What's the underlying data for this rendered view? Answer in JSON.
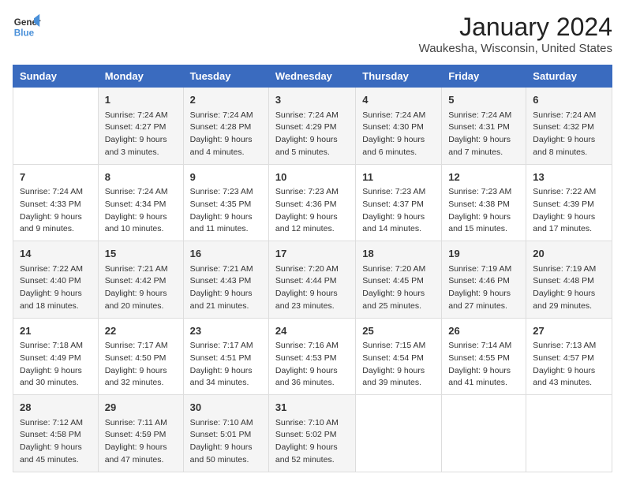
{
  "logo": {
    "line1": "General",
    "line2": "Blue"
  },
  "title": "January 2024",
  "subtitle": "Waukesha, Wisconsin, United States",
  "days_of_week": [
    "Sunday",
    "Monday",
    "Tuesday",
    "Wednesday",
    "Thursday",
    "Friday",
    "Saturday"
  ],
  "weeks": [
    [
      {
        "day": "",
        "content": ""
      },
      {
        "day": "1",
        "content": "Sunrise: 7:24 AM\nSunset: 4:27 PM\nDaylight: 9 hours\nand 3 minutes."
      },
      {
        "day": "2",
        "content": "Sunrise: 7:24 AM\nSunset: 4:28 PM\nDaylight: 9 hours\nand 4 minutes."
      },
      {
        "day": "3",
        "content": "Sunrise: 7:24 AM\nSunset: 4:29 PM\nDaylight: 9 hours\nand 5 minutes."
      },
      {
        "day": "4",
        "content": "Sunrise: 7:24 AM\nSunset: 4:30 PM\nDaylight: 9 hours\nand 6 minutes."
      },
      {
        "day": "5",
        "content": "Sunrise: 7:24 AM\nSunset: 4:31 PM\nDaylight: 9 hours\nand 7 minutes."
      },
      {
        "day": "6",
        "content": "Sunrise: 7:24 AM\nSunset: 4:32 PM\nDaylight: 9 hours\nand 8 minutes."
      }
    ],
    [
      {
        "day": "7",
        "content": "Sunrise: 7:24 AM\nSunset: 4:33 PM\nDaylight: 9 hours\nand 9 minutes."
      },
      {
        "day": "8",
        "content": "Sunrise: 7:24 AM\nSunset: 4:34 PM\nDaylight: 9 hours\nand 10 minutes."
      },
      {
        "day": "9",
        "content": "Sunrise: 7:23 AM\nSunset: 4:35 PM\nDaylight: 9 hours\nand 11 minutes."
      },
      {
        "day": "10",
        "content": "Sunrise: 7:23 AM\nSunset: 4:36 PM\nDaylight: 9 hours\nand 12 minutes."
      },
      {
        "day": "11",
        "content": "Sunrise: 7:23 AM\nSunset: 4:37 PM\nDaylight: 9 hours\nand 14 minutes."
      },
      {
        "day": "12",
        "content": "Sunrise: 7:23 AM\nSunset: 4:38 PM\nDaylight: 9 hours\nand 15 minutes."
      },
      {
        "day": "13",
        "content": "Sunrise: 7:22 AM\nSunset: 4:39 PM\nDaylight: 9 hours\nand 17 minutes."
      }
    ],
    [
      {
        "day": "14",
        "content": "Sunrise: 7:22 AM\nSunset: 4:40 PM\nDaylight: 9 hours\nand 18 minutes."
      },
      {
        "day": "15",
        "content": "Sunrise: 7:21 AM\nSunset: 4:42 PM\nDaylight: 9 hours\nand 20 minutes."
      },
      {
        "day": "16",
        "content": "Sunrise: 7:21 AM\nSunset: 4:43 PM\nDaylight: 9 hours\nand 21 minutes."
      },
      {
        "day": "17",
        "content": "Sunrise: 7:20 AM\nSunset: 4:44 PM\nDaylight: 9 hours\nand 23 minutes."
      },
      {
        "day": "18",
        "content": "Sunrise: 7:20 AM\nSunset: 4:45 PM\nDaylight: 9 hours\nand 25 minutes."
      },
      {
        "day": "19",
        "content": "Sunrise: 7:19 AM\nSunset: 4:46 PM\nDaylight: 9 hours\nand 27 minutes."
      },
      {
        "day": "20",
        "content": "Sunrise: 7:19 AM\nSunset: 4:48 PM\nDaylight: 9 hours\nand 29 minutes."
      }
    ],
    [
      {
        "day": "21",
        "content": "Sunrise: 7:18 AM\nSunset: 4:49 PM\nDaylight: 9 hours\nand 30 minutes."
      },
      {
        "day": "22",
        "content": "Sunrise: 7:17 AM\nSunset: 4:50 PM\nDaylight: 9 hours\nand 32 minutes."
      },
      {
        "day": "23",
        "content": "Sunrise: 7:17 AM\nSunset: 4:51 PM\nDaylight: 9 hours\nand 34 minutes."
      },
      {
        "day": "24",
        "content": "Sunrise: 7:16 AM\nSunset: 4:53 PM\nDaylight: 9 hours\nand 36 minutes."
      },
      {
        "day": "25",
        "content": "Sunrise: 7:15 AM\nSunset: 4:54 PM\nDaylight: 9 hours\nand 39 minutes."
      },
      {
        "day": "26",
        "content": "Sunrise: 7:14 AM\nSunset: 4:55 PM\nDaylight: 9 hours\nand 41 minutes."
      },
      {
        "day": "27",
        "content": "Sunrise: 7:13 AM\nSunset: 4:57 PM\nDaylight: 9 hours\nand 43 minutes."
      }
    ],
    [
      {
        "day": "28",
        "content": "Sunrise: 7:12 AM\nSunset: 4:58 PM\nDaylight: 9 hours\nand 45 minutes."
      },
      {
        "day": "29",
        "content": "Sunrise: 7:11 AM\nSunset: 4:59 PM\nDaylight: 9 hours\nand 47 minutes."
      },
      {
        "day": "30",
        "content": "Sunrise: 7:10 AM\nSunset: 5:01 PM\nDaylight: 9 hours\nand 50 minutes."
      },
      {
        "day": "31",
        "content": "Sunrise: 7:10 AM\nSunset: 5:02 PM\nDaylight: 9 hours\nand 52 minutes."
      },
      {
        "day": "",
        "content": ""
      },
      {
        "day": "",
        "content": ""
      },
      {
        "day": "",
        "content": ""
      }
    ]
  ]
}
